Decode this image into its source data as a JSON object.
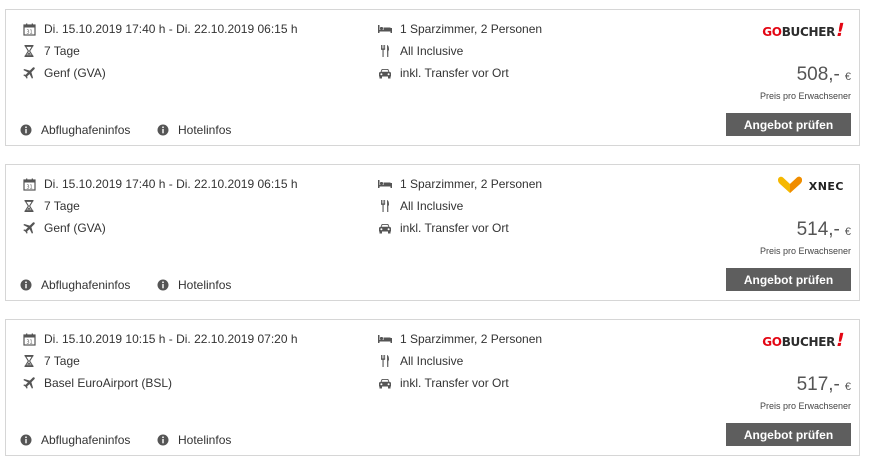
{
  "common": {
    "details_link": "Abflughafeninfos",
    "hotel_link": "Hotelinfos",
    "price_note": "Preis pro Erwachsener",
    "button_label": "Angebot prüfen",
    "currency": "€"
  },
  "offers": [
    {
      "dates": "Di. 15.10.2019 17:40 h - Di. 22.10.2019 06:15 h",
      "duration": "7 Tage",
      "airport": "Genf (GVA)",
      "room": "1 Sparzimmer, 2 Personen",
      "board": "All Inclusive",
      "transfer": "inkl. Transfer vor Ort",
      "operator": "gobucher",
      "logo_go": "GO",
      "logo_rest": "BUCHER",
      "logo_bang": "!",
      "price": "508,-"
    },
    {
      "dates": "Di. 15.10.2019 17:40 h - Di. 22.10.2019 06:15 h",
      "duration": "7 Tage",
      "airport": "Genf (GVA)",
      "room": "1 Sparzimmer, 2 Personen",
      "board": "All Inclusive",
      "transfer": "inkl. Transfer vor Ort",
      "operator": "xnec",
      "logo_text": "XNEC",
      "price": "514,-"
    },
    {
      "dates": "Di. 15.10.2019 10:15 h - Di. 22.10.2019 07:20 h",
      "duration": "7 Tage",
      "airport": "Basel EuroAirport (BSL)",
      "room": "1 Sparzimmer, 2 Personen",
      "board": "All Inclusive",
      "transfer": "inkl. Transfer vor Ort",
      "operator": "gobucher",
      "logo_go": "GO",
      "logo_rest": "BUCHER",
      "logo_bang": "!",
      "price": "517,-"
    }
  ],
  "colors": {
    "button_bg": "#5e5e5e",
    "brand_red": "#e30613",
    "xnec_yellow": "#f5b800"
  }
}
